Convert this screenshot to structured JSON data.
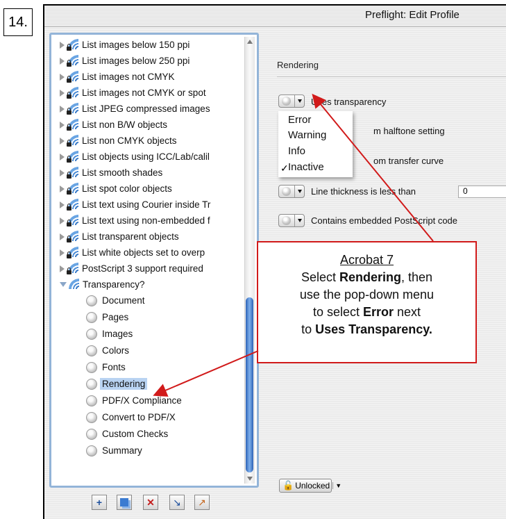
{
  "step_number": "14.",
  "window": {
    "title": "Preflight: Edit Profile"
  },
  "tree": {
    "items": [
      {
        "label": "List images below 150 ppi"
      },
      {
        "label": "List images below 250 ppi"
      },
      {
        "label": "List images not CMYK"
      },
      {
        "label": "List images not CMYK or spot"
      },
      {
        "label": "List JPEG compressed images"
      },
      {
        "label": "List non B/W objects"
      },
      {
        "label": "List non CMYK objects"
      },
      {
        "label": "List objects using ICC/Lab/calil"
      },
      {
        "label": "List smooth shades"
      },
      {
        "label": "List spot color objects"
      },
      {
        "label": "List text using Courier inside Tr"
      },
      {
        "label": "List text using non-embedded f"
      },
      {
        "label": "List transparent objects"
      },
      {
        "label": "List white objects set to overp"
      },
      {
        "label": "PostScript 3 support required"
      }
    ],
    "open_profile": "Transparency?",
    "children": [
      "Document",
      "Pages",
      "Images",
      "Colors",
      "Fonts",
      "Rendering",
      "PDF/X Compliance",
      "Convert to PDF/X",
      "Custom Checks",
      "Summary"
    ],
    "selected": "Rendering"
  },
  "panel": {
    "section_title": "Rendering",
    "checks": {
      "uses_transparency": "Uses transparency",
      "halftone": "m halftone setting",
      "transfer": "om transfer curve",
      "line_thickness": "Line thickness is less than",
      "line_thickness_value": "0",
      "postscript": "Contains embedded PostScript code"
    },
    "menu": {
      "items": [
        "Error",
        "Warning",
        "Info",
        "Inactive"
      ],
      "checked": "Inactive",
      "check_mark": "✓"
    },
    "lock_label": "Unlocked"
  },
  "callout": {
    "title": "Acrobat 7",
    "line1_pre": "Select ",
    "line1_bold": "Rendering",
    "line1_post": ", then",
    "line2": "use the pop-down menu",
    "line3_pre": "to select ",
    "line3_bold": "Error",
    "line3_post": " next",
    "line4_pre": "to ",
    "line4_bold": "Uses Transparency."
  },
  "colors": {
    "accent_red": "#d11a1a",
    "selection": "#b9d3f2",
    "scroll_thumb": "#2c62b6"
  }
}
